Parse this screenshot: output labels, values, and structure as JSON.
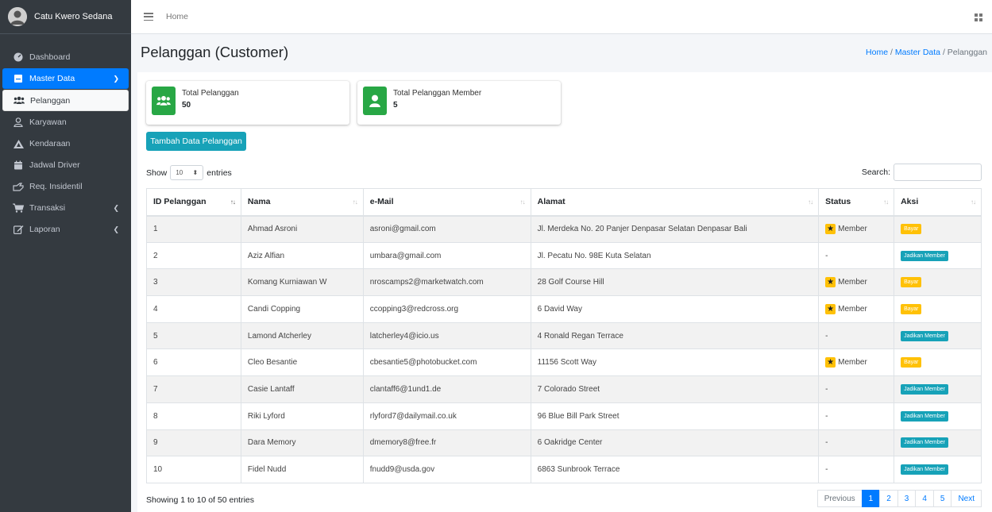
{
  "brand": {
    "name": "Catu Kwero Sedana"
  },
  "sidebar": {
    "items": [
      {
        "label": "Dashboard",
        "icon": "tachometer-icon"
      },
      {
        "label": "Master Data",
        "icon": "database-icon"
      },
      {
        "label": "Pelanggan",
        "icon": "users-icon"
      },
      {
        "label": "Karyawan",
        "icon": "user-icon"
      },
      {
        "label": "Kendaraan",
        "icon": "truck-icon"
      },
      {
        "label": "Jadwal Driver",
        "icon": "calendar-icon"
      },
      {
        "label": "Req. Insidentil",
        "icon": "hand-icon"
      },
      {
        "label": "Transaksi",
        "icon": "cart-icon"
      },
      {
        "label": "Laporan",
        "icon": "edit-icon"
      }
    ]
  },
  "topbar": {
    "home": "Home"
  },
  "header": {
    "title": "Pelanggan (Customer)",
    "breadcrumb": [
      "Home",
      "Master Data",
      "Pelanggan"
    ],
    "sep": "/"
  },
  "stats": [
    {
      "label": "Total Pelanggan",
      "value": "50"
    },
    {
      "label": "Total Pelanggan Member",
      "value": "5"
    }
  ],
  "add_button": "Tambah Data Pelanggan",
  "table_controls": {
    "show": "Show",
    "entries_value": "10",
    "entries": "entries",
    "search": "Search:"
  },
  "table": {
    "columns": [
      "ID Pelanggan",
      "Nama",
      "e-Mail",
      "Alamat",
      "Status",
      "Aksi"
    ],
    "rows": [
      {
        "id": "1",
        "nama": "Ahmad Asroni",
        "email": "asroni@gmail.com",
        "alamat": "Jl. Merdeka No. 20 Panjer Denpasar Selatan Denpasar Bali",
        "status": "Member",
        "aksi": "Bayar"
      },
      {
        "id": "2",
        "nama": "Aziz Alfian",
        "email": "umbara@gmail.com",
        "alamat": "Jl. Pecatu No. 98E Kuta Selatan",
        "status": "-",
        "aksi": "Jadikan Member"
      },
      {
        "id": "3",
        "nama": "Komang Kurniawan W",
        "email": "nroscamps2@marketwatch.com",
        "alamat": "28 Golf Course Hill",
        "status": "Member",
        "aksi": "Bayar"
      },
      {
        "id": "4",
        "nama": "Candi Copping",
        "email": "ccopping3@redcross.org",
        "alamat": "6 David Way",
        "status": "Member",
        "aksi": "Bayar"
      },
      {
        "id": "5",
        "nama": "Lamond Atcherley",
        "email": "latcherley4@icio.us",
        "alamat": "4 Ronald Regan Terrace",
        "status": "-",
        "aksi": "Jadikan Member"
      },
      {
        "id": "6",
        "nama": "Cleo Besantie",
        "email": "cbesantie5@photobucket.com",
        "alamat": "11156 Scott Way",
        "status": "Member",
        "aksi": "Bayar"
      },
      {
        "id": "7",
        "nama": "Casie Lantaff",
        "email": "clantaff6@1und1.de",
        "alamat": "7 Colorado Street",
        "status": "-",
        "aksi": "Jadikan Member"
      },
      {
        "id": "8",
        "nama": "Riki Lyford",
        "email": "rlyford7@dailymail.co.uk",
        "alamat": "96 Blue Bill Park Street",
        "status": "-",
        "aksi": "Jadikan Member"
      },
      {
        "id": "9",
        "nama": "Dara Memory",
        "email": "dmemory8@free.fr",
        "alamat": "6 Oakridge Center",
        "status": "-",
        "aksi": "Jadikan Member"
      },
      {
        "id": "10",
        "nama": "Fidel Nudd",
        "email": "fnudd9@usda.gov",
        "alamat": "6863 Sunbrook Terrace",
        "status": "-",
        "aksi": "Jadikan Member"
      }
    ]
  },
  "footer": {
    "info": "Showing 1 to 10 of 50 entries"
  },
  "pagination": {
    "prev": "Previous",
    "pages": [
      "1",
      "2",
      "3",
      "4",
      "5"
    ],
    "next": "Next",
    "current": "1"
  },
  "colors": {
    "primary": "#007bff",
    "info": "#17a2b8",
    "success": "#28a745",
    "warning": "#ffc107",
    "sidebar": "#343a40"
  }
}
